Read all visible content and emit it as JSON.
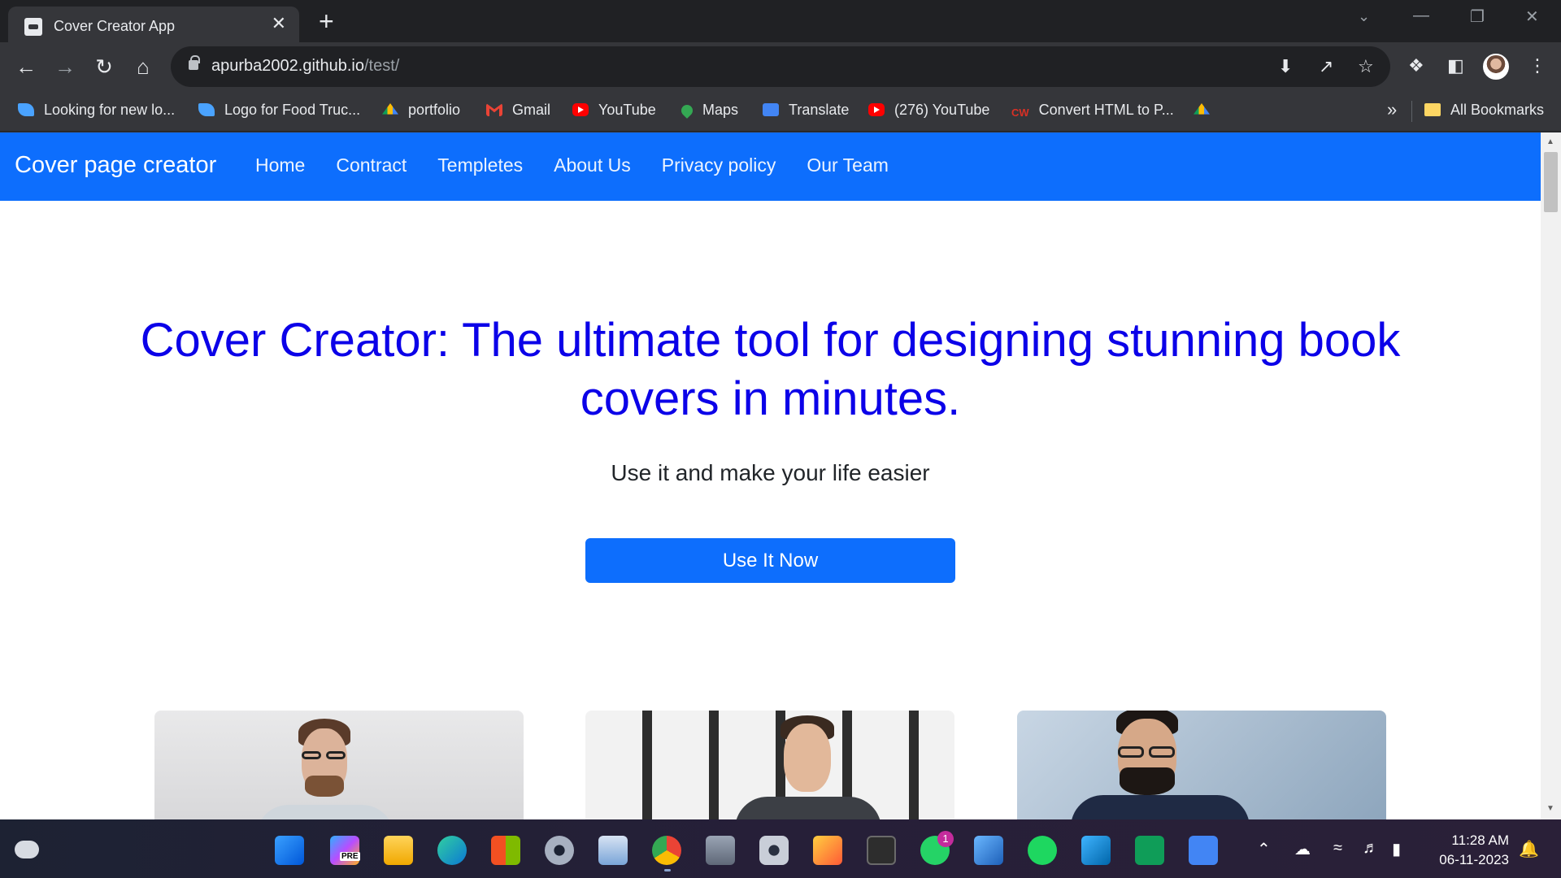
{
  "browser": {
    "tab_title": "Cover Creator App",
    "tab_close": "✕",
    "new_tab": "+",
    "url_host": "apurba2002.github.io",
    "url_path": "/test/",
    "bookmarks": [
      {
        "label": "Looking for new lo...",
        "icon": "bird"
      },
      {
        "label": "Logo for Food Truc...",
        "icon": "bird"
      },
      {
        "label": "portfolio",
        "icon": "drive"
      },
      {
        "label": "Gmail",
        "icon": "gmail"
      },
      {
        "label": "YouTube",
        "icon": "yt"
      },
      {
        "label": "Maps",
        "icon": "maps"
      },
      {
        "label": "Translate",
        "icon": "translate"
      },
      {
        "label": "(276) YouTube",
        "icon": "yt"
      },
      {
        "label": "Convert HTML to P...",
        "icon": "cw"
      }
    ],
    "bookmarks_overflow": "»",
    "all_bookmarks": "All Bookmarks"
  },
  "site": {
    "brand": "Cover page creator",
    "nav": [
      "Home",
      "Contract",
      "Templetes",
      "About Us",
      "Privacy policy",
      "Our Team"
    ],
    "hero_title": "Cover Creator: The ultimate tool for designing stunning book covers in minutes.",
    "hero_subtitle": "Use it and make your life easier",
    "cta_label": "Use It Now",
    "brand_color": "#0d6efd",
    "title_color": "#0b00e8"
  },
  "taskbar": {
    "time": "11:28 AM",
    "date": "06-11-2023",
    "whatsapp_badge": "1",
    "copilot_badge": "PRE"
  }
}
